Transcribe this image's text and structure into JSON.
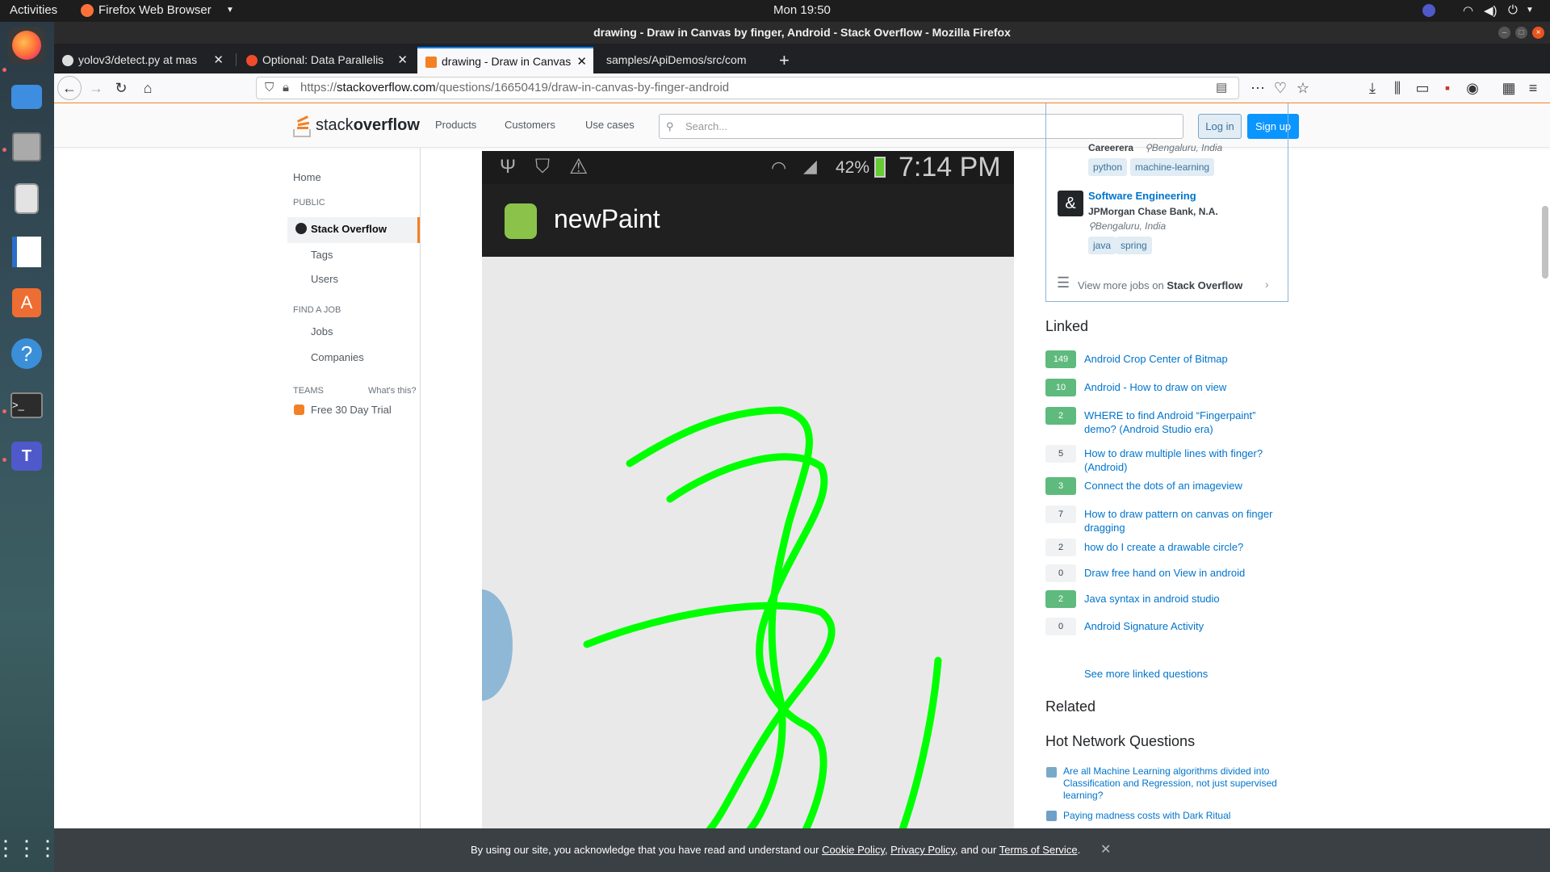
{
  "topbar": {
    "activities": "Activities",
    "app_menu": "Firefox Web Browser",
    "clock": "Mon 19:50"
  },
  "window": {
    "title": "drawing - Draw in Canvas by finger, Android - Stack Overflow - Mozilla Firefox"
  },
  "tabs": [
    {
      "label": "yolov3/detect.py at mas",
      "icon": "github-icon"
    },
    {
      "label": "Optional: Data Parallelis",
      "icon": "pytorch-icon"
    },
    {
      "label": "drawing - Draw in Canvas",
      "icon": "stackoverflow-icon",
      "active": true
    },
    {
      "label": "samples/ApiDemos/src/com",
      "icon": "none"
    }
  ],
  "navbar": {
    "url_prefix": "https://",
    "url_domain": "stackoverflow.com",
    "url_path": "/questions/16650419/draw-in-canvas-by-finger-android"
  },
  "so_header": {
    "logo_text_1": "stack",
    "logo_text_2": "overflow",
    "products": "Products",
    "customers": "Customers",
    "use_cases": "Use cases",
    "search_placeholder": "Search...",
    "login": "Log in",
    "signup": "Sign up"
  },
  "leftnav": {
    "home": "Home",
    "public_head": "PUBLIC",
    "stack_overflow": "Stack Overflow",
    "tags": "Tags",
    "users": "Users",
    "find_job_head": "FIND A JOB",
    "jobs": "Jobs",
    "companies": "Companies",
    "teams_head": "TEAMS",
    "whats_this": "What's this?",
    "free_trial": "Free 30 Day Trial"
  },
  "phone": {
    "battery": "42%",
    "time": "7:14 PM",
    "app_name": "newPaint",
    "stroke_color": "#00ff00"
  },
  "jobs": {
    "job1_company": "Careerera",
    "job1_location": "Bengaluru, India",
    "job1_tags": [
      "python",
      "machine-learning"
    ],
    "job2_title": "Software Engineering",
    "job2_company": "JPMorgan Chase Bank, N.A.",
    "job2_location": "Bengaluru, India",
    "job2_tags": [
      "java",
      "spring"
    ],
    "view_more_prefix": "View more jobs on ",
    "view_more_bold": "Stack Overflow"
  },
  "linked": {
    "heading": "Linked",
    "items": [
      {
        "score": "149",
        "title": "Android Crop Center of Bitmap",
        "accepted": true
      },
      {
        "score": "10",
        "title": "Android - How to draw on view",
        "accepted": true
      },
      {
        "score": "2",
        "title": "WHERE to find Android “Fingerpaint” demo? (Android Studio era)",
        "accepted": true
      },
      {
        "score": "5",
        "title": "How to draw multiple lines with finger? (Android)",
        "accepted": false
      },
      {
        "score": "3",
        "title": "Connect the dots of an imageview",
        "accepted": true
      },
      {
        "score": "7",
        "title": "How to draw pattern on canvas on finger dragging",
        "accepted": false
      },
      {
        "score": "2",
        "title": "how do I create a drawable circle?",
        "accepted": false
      },
      {
        "score": "0",
        "title": "Draw free hand on View in android",
        "accepted": false
      },
      {
        "score": "2",
        "title": "Java syntax in android studio",
        "accepted": true
      },
      {
        "score": "0",
        "title": "Android Signature Activity",
        "accepted": false
      }
    ],
    "see_more": "See more linked questions"
  },
  "related": {
    "heading": "Related"
  },
  "hot": {
    "heading": "Hot Network Questions",
    "items": [
      "Are all Machine Learning algorithms divided into Classification and Regression, not just supervised learning?",
      "Paying madness costs with Dark Ritual"
    ]
  },
  "cookie": {
    "text1": "By using our site, you acknowledge that you have read and understand our ",
    "cookie_policy": "Cookie Policy",
    "sep1": ", ",
    "privacy_policy": "Privacy Policy",
    "sep2": ", and our ",
    "terms": "Terms of Service",
    "end": "."
  },
  "colors": {
    "so_orange": "#f48024",
    "so_blue": "#0a95ff",
    "accepted_green": "#5eba7d"
  }
}
